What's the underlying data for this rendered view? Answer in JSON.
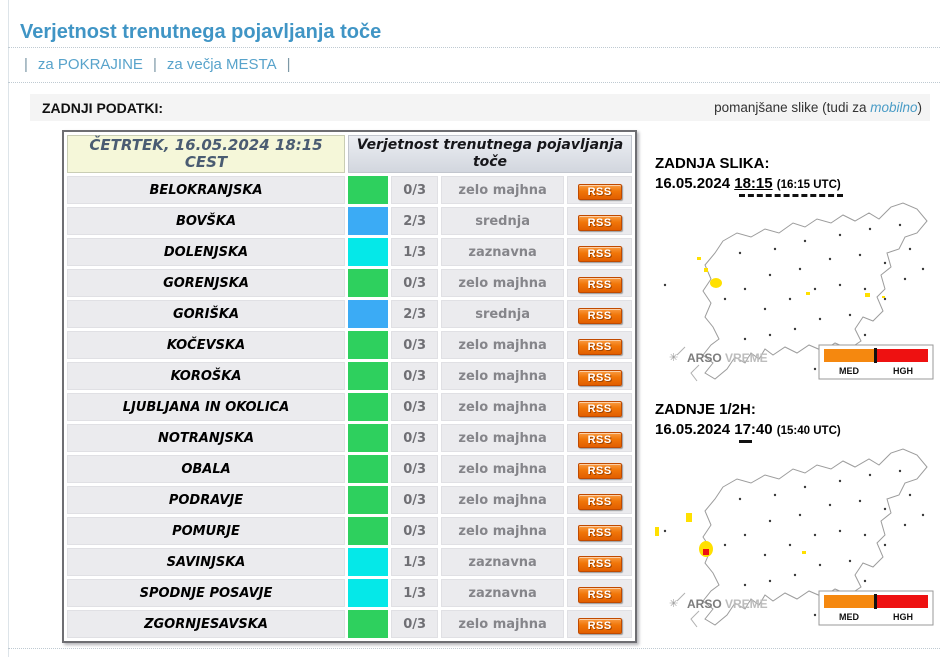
{
  "page": {
    "title": "Verjetnost trenutnega pojavljanja toče",
    "nav": {
      "separator": "|",
      "items": [
        {
          "label": "za POKRAJINE"
        },
        {
          "label": "za večja MESTA"
        }
      ]
    },
    "strip": {
      "last_data_label": "ZADNJI PODATKI:",
      "thumbs_prefix": "pomanjšane slike (tudi za ",
      "thumbs_link": "mobilno",
      "thumbs_suffix": ")"
    }
  },
  "colors": {
    "accent_blue": "#4095c5",
    "link_blue": "#58a3cb",
    "green_low": "#2ed05e",
    "blue_medium": "#3babf5",
    "cyan_detectable": "#05e8e8",
    "rss_orange": "#f07508",
    "legend_med": "#f5880f",
    "legend_hgh": "#ee1111"
  },
  "table": {
    "header_datetime_line1": "ČETRTEK, 16.05.2024 18:15",
    "header_datetime_line2": "CEST",
    "header_title": "Verjetnost trenutnega pojavljanja toče",
    "rss_label": "RSS",
    "rows": [
      {
        "region": "BELOKRANJSKA",
        "color": "#2ed05e",
        "ratio": "0/3",
        "level": "zelo majhna"
      },
      {
        "region": "BOVŠKA",
        "color": "#3babf5",
        "ratio": "2/3",
        "level": "srednja"
      },
      {
        "region": "DOLENJSKA",
        "color": "#05e8e8",
        "ratio": "1/3",
        "level": "zaznavna"
      },
      {
        "region": "GORENJSKA",
        "color": "#2ed05e",
        "ratio": "0/3",
        "level": "zelo majhna"
      },
      {
        "region": "GORIŠKA",
        "color": "#3babf5",
        "ratio": "2/3",
        "level": "srednja"
      },
      {
        "region": "KOČEVSKA",
        "color": "#2ed05e",
        "ratio": "0/3",
        "level": "zelo majhna"
      },
      {
        "region": "KOROŠKA",
        "color": "#2ed05e",
        "ratio": "0/3",
        "level": "zelo majhna"
      },
      {
        "region": "LJUBLJANA IN OKOLICA",
        "color": "#2ed05e",
        "ratio": "0/3",
        "level": "zelo majhna"
      },
      {
        "region": "NOTRANJSKA",
        "color": "#2ed05e",
        "ratio": "0/3",
        "level": "zelo majhna"
      },
      {
        "region": "OBALA",
        "color": "#2ed05e",
        "ratio": "0/3",
        "level": "zelo majhna"
      },
      {
        "region": "PODRAVJE",
        "color": "#2ed05e",
        "ratio": "0/3",
        "level": "zelo majhna"
      },
      {
        "region": "POMURJE",
        "color": "#2ed05e",
        "ratio": "0/3",
        "level": "zelo majhna"
      },
      {
        "region": "SAVINJSKA",
        "color": "#05e8e8",
        "ratio": "1/3",
        "level": "zaznavna"
      },
      {
        "region": "SPODNJE POSAVJE",
        "color": "#05e8e8",
        "ratio": "1/3",
        "level": "zaznavna"
      },
      {
        "region": "ZGORNJESAVSKA",
        "color": "#2ed05e",
        "ratio": "0/3",
        "level": "zelo majhna"
      }
    ]
  },
  "maps": [
    {
      "heading": "ZADNJA SLIKA:",
      "date": "16.05.2024",
      "time": "18:15",
      "utc": "(16:15 UTC)",
      "watermark_bold": "ARSO",
      "watermark_light": "VREME",
      "legend": {
        "med": "MED",
        "hgh": "HGH",
        "med_color": "#f5880f",
        "hgh_color": "#ee1111"
      }
    },
    {
      "heading": "ZADNJE 1/2H:",
      "date": "16.05.2024",
      "time": "17:40",
      "utc": "(15:40 UTC)",
      "watermark_bold": "ARSO",
      "watermark_light": "VREME",
      "legend": {
        "med": "MED",
        "hgh": "HGH",
        "med_color": "#f5880f",
        "hgh_color": "#ee1111"
      }
    }
  ]
}
